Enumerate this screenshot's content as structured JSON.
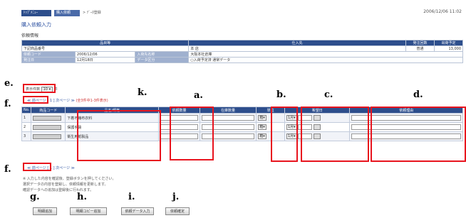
{
  "nav": {
    "tab1": "ﾄｯﾌﾟﾒﾆｭｰ",
    "tab2": "購入依頼",
    "path": "> ﾃﾞｰﾀ登録",
    "datetime": "2006/12/06 11:02"
  },
  "page": {
    "title": "購入依頼入力",
    "section": "依頼情報"
  },
  "info": {
    "headers": [
      "品目等",
      "仕入先",
      "発注回数",
      "出荷予定"
    ],
    "row1": [
      "下記商品番号",
      "本 店",
      "普通",
      "13,000"
    ],
    "label1": "依頼コード",
    "value1": "2006/12/06",
    "label2": "入荷先名称",
    "value2": "大阪本社倉庫",
    "label3": "発注日",
    "value3": "12月18日",
    "label4": "データ区分",
    "value4": "○入荷予定済 通常データ"
  },
  "controls": {
    "display_label": "表示件数",
    "display_value": "10",
    "display_unit": "件",
    "pager_text": "≪ 前ページ [ 1 ] 次ページ ≫",
    "pager_note": "(全3件中1-3件表示)"
  },
  "items": {
    "headers": [
      "No.",
      "商品コード",
      "品名/規格",
      "依頼数量",
      "在庫数量",
      "単位",
      "希望日",
      "依頼理由"
    ],
    "rows": [
      {
        "no": "1",
        "name": "下着不織布衣料",
        "unit": "箱",
        "month": "1月",
        "day": "1"
      },
      {
        "no": "2",
        "name": "保護手袋",
        "unit": "箱",
        "month": "1月",
        "day": "1"
      },
      {
        "no": "3",
        "name": "衛生用紙製品",
        "unit": "箱",
        "month": "1月",
        "day": "1"
      }
    ]
  },
  "notes": [
    "※ 入力した内容を確認後、登録ボタンを押してください。",
    "選択データの内容を登録し、依頼情報を更新します。",
    "確認データへの追加は登録後に行われます。"
  ],
  "buttons": {
    "g": "明細追加",
    "h": "明細コピー追加",
    "i": "依頼データ入力",
    "j": "依頼確定"
  },
  "annotations": {
    "a": "a.",
    "b": "b.",
    "c": "c.",
    "d": "d.",
    "e": "e.",
    "f_top": "f.",
    "f_bottom": "f.",
    "g": "g.",
    "h": "h.",
    "i": "i.",
    "j": "j.",
    "k": "k."
  }
}
